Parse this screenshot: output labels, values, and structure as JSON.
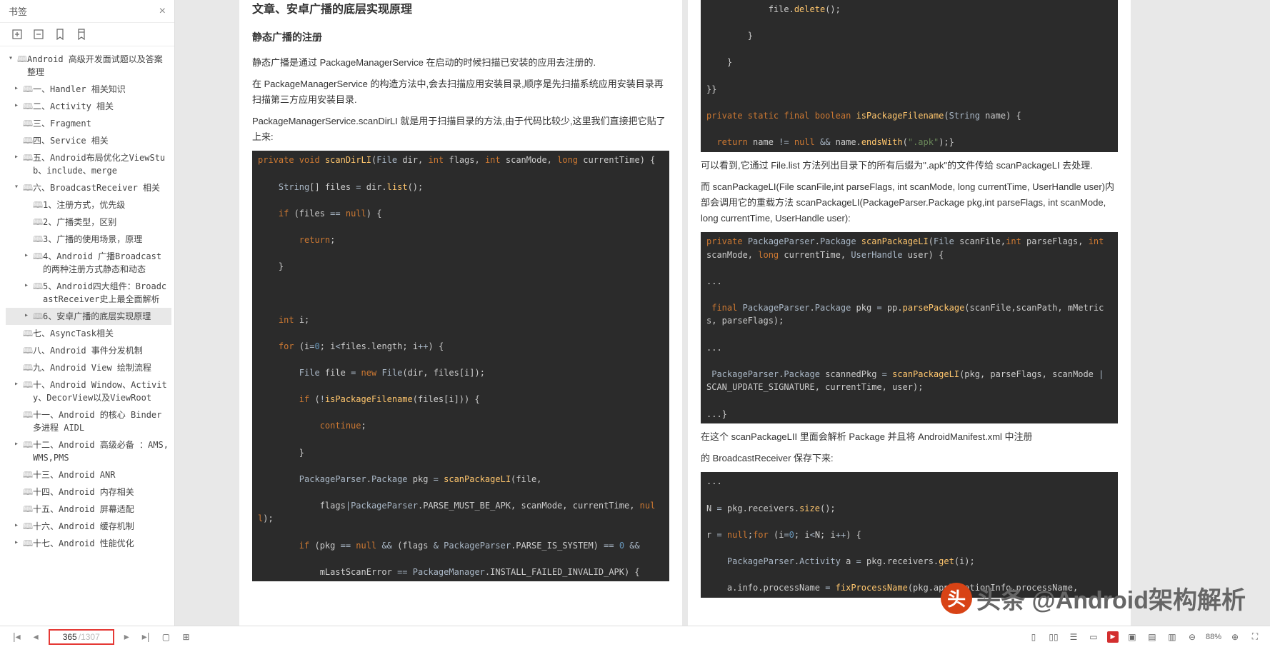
{
  "sidebar": {
    "title": "书签",
    "tree": [
      {
        "lvl": 0,
        "exp": "▾",
        "label": "Android 高级开发面试题以及答案整理"
      },
      {
        "lvl": 1,
        "exp": "▸",
        "label": "一、Handler 相关知识"
      },
      {
        "lvl": 1,
        "exp": "▸",
        "label": "二、Activity 相关"
      },
      {
        "lvl": 1,
        "exp": "",
        "label": "三、Fragment"
      },
      {
        "lvl": 1,
        "exp": "",
        "label": "四、Service 相关"
      },
      {
        "lvl": 1,
        "exp": "▸",
        "label": "五、Android布局优化之ViewStub、include、merge"
      },
      {
        "lvl": 1,
        "exp": "▾",
        "label": "六、BroadcastReceiver 相关"
      },
      {
        "lvl": 2,
        "exp": "",
        "label": "1、注册方式，优先级"
      },
      {
        "lvl": 2,
        "exp": "",
        "label": "2、广播类型，区别"
      },
      {
        "lvl": 2,
        "exp": "",
        "label": "3、广播的使用场景，原理"
      },
      {
        "lvl": 2,
        "exp": "▸",
        "label": "4、Android 广播Broadcast的两种注册方式静态和动态"
      },
      {
        "lvl": 2,
        "exp": "▸",
        "label": "5、Android四大组件：BroadcastReceiver史上最全面解析"
      },
      {
        "lvl": 2,
        "exp": "▸",
        "label": "6、安卓广播的底层实现原理",
        "sel": true
      },
      {
        "lvl": 1,
        "exp": "",
        "label": "七、AsyncTask相关"
      },
      {
        "lvl": 1,
        "exp": "",
        "label": "八、Android 事件分发机制"
      },
      {
        "lvl": 1,
        "exp": "",
        "label": "九、Android View 绘制流程"
      },
      {
        "lvl": 1,
        "exp": "▸",
        "label": "十、Android Window、Activity、DecorView以及ViewRoot"
      },
      {
        "lvl": 1,
        "exp": "",
        "label": "十一、Android 的核心 Binder 多进程 AIDL"
      },
      {
        "lvl": 1,
        "exp": "▸",
        "label": "十二、Android 高级必备 ：AMS,WMS,PMS"
      },
      {
        "lvl": 1,
        "exp": "",
        "label": "十三、Android ANR"
      },
      {
        "lvl": 1,
        "exp": "",
        "label": "十四、Android 内存相关"
      },
      {
        "lvl": 1,
        "exp": "",
        "label": "十五、Android 屏幕适配"
      },
      {
        "lvl": 1,
        "exp": "▸",
        "label": "十六、Android 缓存机制"
      },
      {
        "lvl": 1,
        "exp": "▸",
        "label": "十七、Android 性能优化"
      }
    ]
  },
  "leftPage": {
    "h2": "文章、安卓广播的底层实现原理",
    "h3": "静态广播的注册",
    "p1": "静态广播是通过 PackageManagerService 在启动的时候扫描已安装的应用去注册的.",
    "p2": "在 PackageManagerService 的构造方法中,会去扫描应用安装目录,顺序是先扫描系统应用安装目录再扫描第三方应用安装目录.",
    "p3": "PackageManagerService.scanDirLI 就是用于扫描目录的方法,由于代码比较少,这里我们直接把它贴了上来:"
  },
  "rightPage": {
    "p1": "可以看到,它通过 File.list 方法列出目录下的所有后缀为\".apk\"的文件传给 scanPackageLI 去处理.",
    "p2": "而 scanPackageLI(File scanFile,int parseFlags, int scanMode, long currentTime, UserHandle user)内部会调用它的重载方法 scanPackageLI(PackageParser.Package pkg,int parseFlags, int scanMode, long currentTime, UserHandle user):",
    "p3": "在这个 scanPackageLII 里面会解析 Package 并且将 AndroidManifest.xml 中注册",
    "p4": "的 BroadcastReceiver 保存下来:"
  },
  "footer": {
    "current": "365",
    "total": "/1307",
    "zoom": "88%"
  },
  "watermark": "头条 @Android架构解析",
  "wmAv": "头"
}
